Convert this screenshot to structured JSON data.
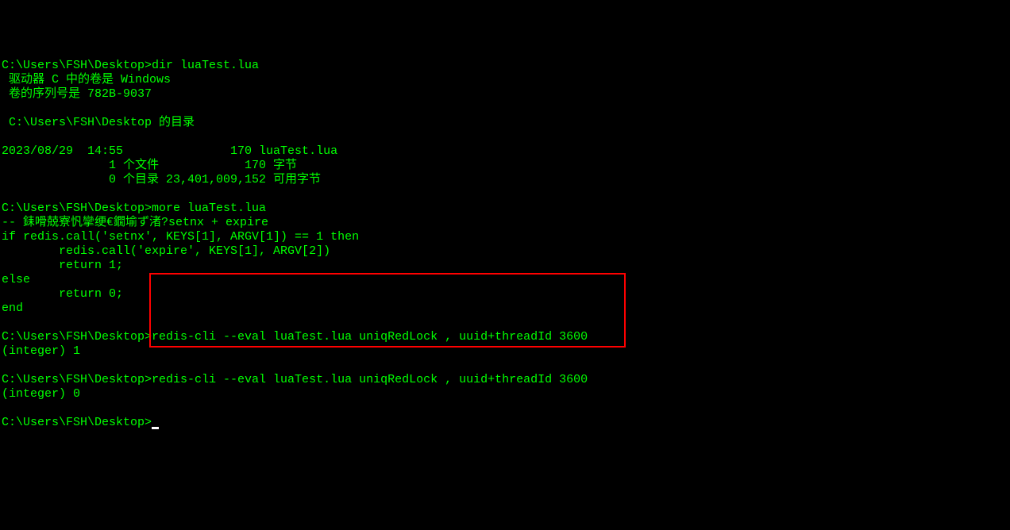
{
  "terminal": {
    "lines": [
      {
        "prompt": "C:\\Users\\FSH\\Desktop>",
        "cmd": "dir luaTest.lua",
        "hasPrompt": true
      },
      {
        "text": " 驱动器 C 中的卷是 Windows"
      },
      {
        "text": " 卷的序列号是 782B-9037"
      },
      {
        "text": ""
      },
      {
        "text": " C:\\Users\\FSH\\Desktop 的目录"
      },
      {
        "text": ""
      },
      {
        "text": "2023/08/29  14:55               170 luaTest.lua"
      },
      {
        "text": "               1 个文件            170 字节"
      },
      {
        "text": "               0 个目录 23,401,009,152 可用字节"
      },
      {
        "text": ""
      },
      {
        "prompt": "C:\\Users\\FSH\\Desktop>",
        "cmd": "more luaTest.lua",
        "hasPrompt": true
      },
      {
        "text": "-- 銇嗗兢寮忛攣绠€鐗堬ず渚?setnx + expire"
      },
      {
        "text": "if redis.call('setnx', KEYS[1], ARGV[1]) == 1 then"
      },
      {
        "text": "        redis.call('expire', KEYS[1], ARGV[2])"
      },
      {
        "text": "        return 1;"
      },
      {
        "text": "else"
      },
      {
        "text": "        return 0;"
      },
      {
        "text": "end"
      },
      {
        "text": ""
      },
      {
        "prompt": "C:\\Users\\FSH\\Desktop>",
        "cmd": "redis-cli --eval luaTest.lua uniqRedLock , uuid+threadId 3600",
        "hasPrompt": true
      },
      {
        "text": "(integer) 1"
      },
      {
        "text": ""
      },
      {
        "prompt": "C:\\Users\\FSH\\Desktop>",
        "cmd": "redis-cli --eval luaTest.lua uniqRedLock , uuid+threadId 3600",
        "hasPrompt": true
      },
      {
        "text": "(integer) 0"
      },
      {
        "text": ""
      },
      {
        "prompt": "C:\\Users\\FSH\\Desktop>",
        "cmd": "",
        "hasPrompt": true,
        "hasCursor": true
      }
    ]
  }
}
